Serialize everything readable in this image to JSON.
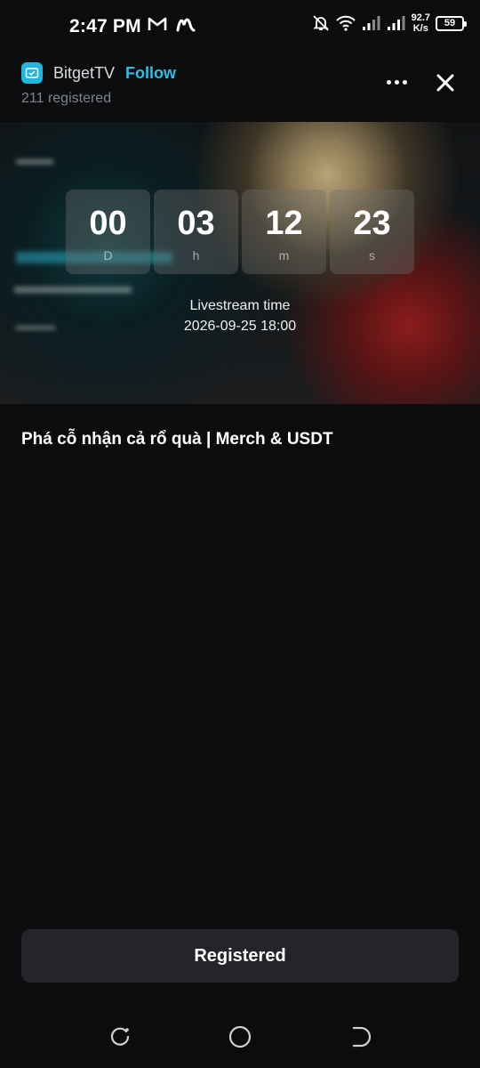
{
  "status_bar": {
    "time": "2:47 PM",
    "net_speed_value": "92.7",
    "net_speed_unit": "K/s",
    "battery": "59",
    "icons": [
      "gmail-icon",
      "m-app-icon",
      "mute-bell-icon",
      "wifi-icon",
      "signal-icon",
      "signal-icon-2"
    ]
  },
  "header": {
    "channel_name": "BitgetTV",
    "follow_label": "Follow",
    "registered_count": "211 registered"
  },
  "countdown": {
    "days": "00",
    "days_unit": "D",
    "hours": "03",
    "hours_unit": "h",
    "minutes": "12",
    "minutes_unit": "m",
    "seconds": "23",
    "seconds_unit": "s"
  },
  "stream": {
    "label": "Livestream time",
    "time": "2026-09-25 18:00"
  },
  "event": {
    "title": "Phá cỗ nhận cả rổ quà | Merch & USDT"
  },
  "action": {
    "button_label": "Registered"
  },
  "colors": {
    "accent": "#2bc0e4",
    "background": "#0b0c0d",
    "button_bg": "#232529"
  }
}
